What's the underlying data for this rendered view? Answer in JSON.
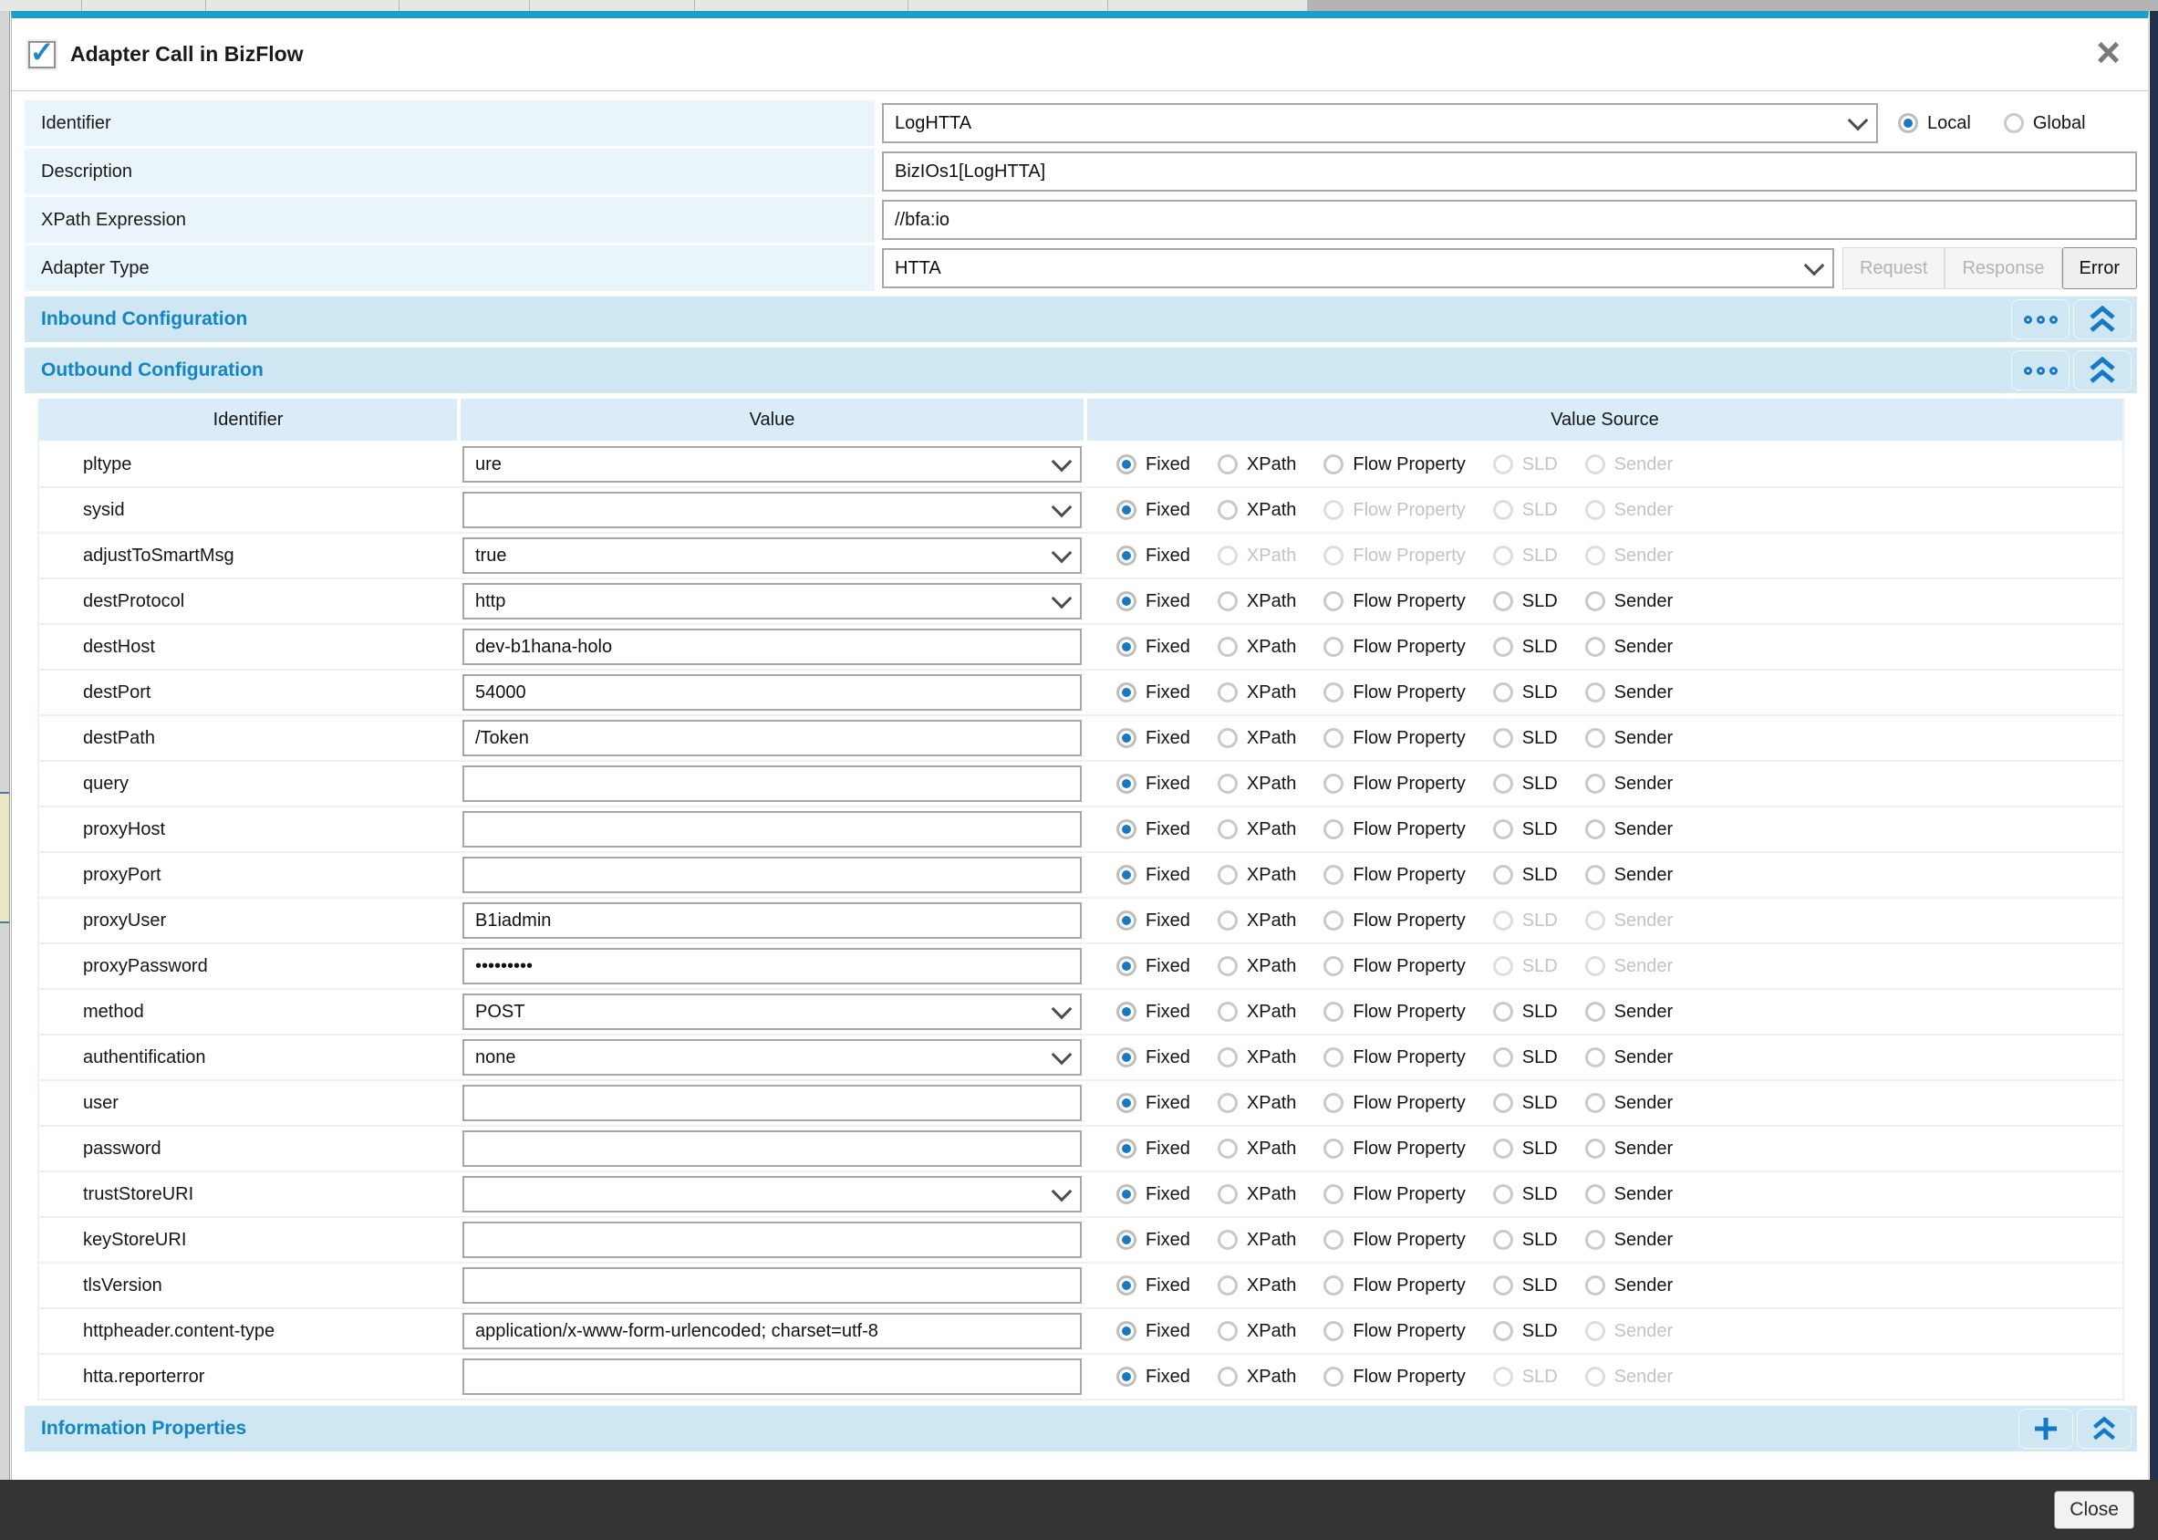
{
  "dialog": {
    "title": "Adapter Call in BizFlow",
    "title_checkbox_checked": true,
    "close_icon": "×",
    "fields": {
      "identifier": {
        "label": "Identifier",
        "value": "LogHTTA"
      },
      "scope": {
        "options": [
          {
            "label": "Local",
            "selected": true
          },
          {
            "label": "Global",
            "selected": false
          }
        ]
      },
      "description": {
        "label": "Description",
        "value": "BizIOs1[LogHTTA]"
      },
      "xpath": {
        "label": "XPath Expression",
        "value": "//bfa:io"
      },
      "adapter_type": {
        "label": "Adapter Type",
        "value": "HTTA"
      },
      "adapter_buttons": [
        {
          "label": "Request",
          "state": "disabled"
        },
        {
          "label": "Response",
          "state": "disabled"
        },
        {
          "label": "Error",
          "state": "active"
        }
      ]
    },
    "sections": {
      "inbound": {
        "title": "Inbound Configuration",
        "icons": [
          "ellipsis-icon",
          "collapse-icon"
        ]
      },
      "outbound": {
        "title": "Outbound Configuration",
        "icons": [
          "ellipsis-icon",
          "collapse-icon"
        ]
      },
      "information": {
        "title": "Information Properties",
        "icons": [
          "add-icon",
          "collapse-icon"
        ]
      }
    },
    "table": {
      "headers": [
        "Identifier",
        "Value",
        "Value Source"
      ],
      "source_options": [
        "Fixed",
        "XPath",
        "Flow Property",
        "SLD",
        "Sender"
      ],
      "rows": [
        {
          "identifier": "pltype",
          "value": "ure",
          "control": "select",
          "selected": "Fixed",
          "disabled": [
            "SLD",
            "Sender"
          ]
        },
        {
          "identifier": "sysid",
          "value": "",
          "control": "select",
          "selected": "Fixed",
          "disabled": [
            "Flow Property",
            "SLD",
            "Sender"
          ]
        },
        {
          "identifier": "adjustToSmartMsg",
          "value": "true",
          "control": "select",
          "selected": "Fixed",
          "disabled": [
            "XPath",
            "Flow Property",
            "SLD",
            "Sender"
          ]
        },
        {
          "identifier": "destProtocol",
          "value": "http",
          "control": "select",
          "selected": "Fixed",
          "disabled": []
        },
        {
          "identifier": "destHost",
          "value": "dev-b1hana-holo",
          "control": "text",
          "selected": "Fixed",
          "disabled": []
        },
        {
          "identifier": "destPort",
          "value": "54000",
          "control": "text",
          "selected": "Fixed",
          "disabled": []
        },
        {
          "identifier": "destPath",
          "value": "/Token",
          "control": "text",
          "selected": "Fixed",
          "disabled": []
        },
        {
          "identifier": "query",
          "value": "",
          "control": "text",
          "selected": "Fixed",
          "disabled": []
        },
        {
          "identifier": "proxyHost",
          "value": "",
          "control": "text",
          "selected": "Fixed",
          "disabled": []
        },
        {
          "identifier": "proxyPort",
          "value": "",
          "control": "text",
          "selected": "Fixed",
          "disabled": []
        },
        {
          "identifier": "proxyUser",
          "value": "B1iadmin",
          "control": "text",
          "selected": "Fixed",
          "disabled": [
            "SLD",
            "Sender"
          ]
        },
        {
          "identifier": "proxyPassword",
          "value": "•••••••••",
          "control": "text",
          "selected": "Fixed",
          "disabled": [
            "SLD",
            "Sender"
          ]
        },
        {
          "identifier": "method",
          "value": "POST",
          "control": "select",
          "selected": "Fixed",
          "disabled": []
        },
        {
          "identifier": "authentification",
          "value": "none",
          "control": "select",
          "selected": "Fixed",
          "disabled": []
        },
        {
          "identifier": "user",
          "value": "",
          "control": "text",
          "selected": "Fixed",
          "disabled": []
        },
        {
          "identifier": "password",
          "value": "",
          "control": "text",
          "selected": "Fixed",
          "disabled": []
        },
        {
          "identifier": "trustStoreURI",
          "value": "",
          "control": "select",
          "selected": "Fixed",
          "disabled": []
        },
        {
          "identifier": "keyStoreURI",
          "value": "",
          "control": "text",
          "selected": "Fixed",
          "disabled": []
        },
        {
          "identifier": "tlsVersion",
          "value": "",
          "control": "text",
          "selected": "Fixed",
          "disabled": []
        },
        {
          "identifier": "httpheader.content-type",
          "value": "application/x-www-form-urlencoded; charset=utf-8",
          "control": "text",
          "selected": "Fixed",
          "disabled": [
            "Sender"
          ]
        },
        {
          "identifier": "htta.reporterror",
          "value": "",
          "control": "text",
          "selected": "Fixed",
          "disabled": [
            "SLD",
            "Sender"
          ]
        }
      ]
    },
    "footer": {
      "close_label": "Close"
    }
  },
  "colors": {
    "accent_border": "#1f9dc9",
    "section_header_bg": "#cfe6f3",
    "section_title_text": "#1385c3",
    "form_label_bg": "#e9f4fb",
    "table_header_bg": "#d9ecf7",
    "radio_selected": "#1779c4",
    "footer_bg": "#333333"
  }
}
